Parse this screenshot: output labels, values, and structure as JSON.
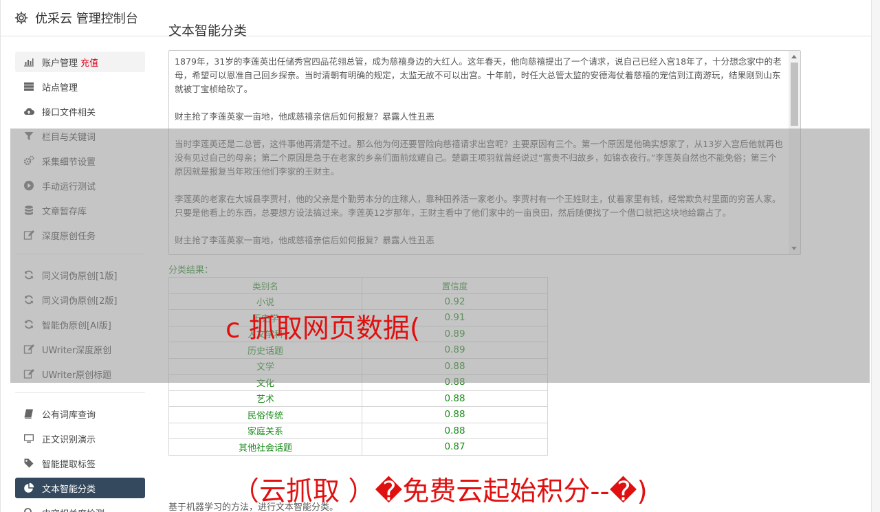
{
  "header": {
    "title": "优采云 管理控制台"
  },
  "sidebar": {
    "group1": [
      {
        "label": "账户管理",
        "badge": "充值",
        "icon": "bar-chart-icon",
        "name": "sidebar-item-account"
      },
      {
        "label": "站点管理",
        "icon": "server-icon",
        "name": "sidebar-item-sites"
      },
      {
        "label": "接口文件相关",
        "icon": "cloud-upload-icon",
        "name": "sidebar-item-interface-files"
      },
      {
        "label": "栏目与关键词",
        "icon": "filter-icon",
        "name": "sidebar-item-keywords"
      },
      {
        "label": "采集细节设置",
        "icon": "gears-icon",
        "name": "sidebar-item-collect-settings"
      },
      {
        "label": "手动运行测试",
        "icon": "play-circle-icon",
        "name": "sidebar-item-manual-test"
      },
      {
        "label": "文章暂存库",
        "icon": "database-icon",
        "name": "sidebar-item-article-store"
      },
      {
        "label": "深度原创任务",
        "icon": "edit-icon",
        "name": "sidebar-item-deep-original"
      }
    ],
    "group2": [
      {
        "label": "同义词伪原创[1版]",
        "icon": "refresh-icon",
        "name": "sidebar-item-synonym-v1"
      },
      {
        "label": "同义词伪原创[2版]",
        "icon": "refresh-icon",
        "name": "sidebar-item-synonym-v2"
      },
      {
        "label": "智能伪原创[AI版]",
        "icon": "refresh-icon",
        "name": "sidebar-item-ai-rewrite"
      },
      {
        "label": "UWriter深度原创",
        "icon": "edit-icon",
        "name": "sidebar-item-uwriter"
      },
      {
        "label": "UWriter原创标题",
        "icon": "edit-icon",
        "name": "sidebar-item-uwriter-title"
      }
    ],
    "group3": [
      {
        "label": "公有词库查询",
        "icon": "book-icon",
        "name": "sidebar-item-public-dict"
      },
      {
        "label": "正文识别演示",
        "icon": "monitor-icon",
        "name": "sidebar-item-text-recognition"
      },
      {
        "label": "智能提取标签",
        "icon": "tag-icon",
        "name": "sidebar-item-extract-tags"
      },
      {
        "label": "文本智能分类",
        "icon": "pie-chart-icon",
        "name": "sidebar-item-text-classify"
      },
      {
        "label": "内容相关度检测",
        "icon": "search-icon",
        "name": "sidebar-item-relevance"
      }
    ]
  },
  "main": {
    "title": "文本智能分类",
    "paragraphs": [
      "1879年，31岁的李莲英出任储秀宫四品花翎总管，成为慈禧身边的大红人。这年春天，他向慈禧提出了一个请求，说自己已经入宫18年了，十分想念家中的老母，希望可以恩准自己回乡探亲。当时清朝有明确的规定，太监无故不可以出宫。十年前，时任大总管太监的安德海仗着慈禧的宠信到江南游玩，结果刚到山东就被丁宝桢给砍了。",
      "财主抢了李莲英家一亩地，他成慈禧亲信后如何报复？暴露人性丑恶",
      "当时李莲英还是二总管，这件事他再清楚不过。那么他为何还要冒险向慈禧请求出宫呢？主要原因有三个。第一个原因是他确实想家了，从13岁入宫后他就再也没有见过自己的母亲；第二个原因是急于在老家的乡亲们面前炫耀自己。楚霸王项羽就曾经说过“富贵不归故乡，如锦衣夜行。”李莲英自然也不能免俗；第三个原因就是报复当年欺压他们李家的王财主。",
      "李莲英的老家在大城县李贾村，他的父亲是个勤劳本分的庄稼人，靠种田养活一家老小。李贾村有一个王姓财主，仗着家里有钱，经常欺负村里面的穷苦人家。只要是他看上的东西，总要想方设法搞过来。李莲英12岁那年，王财主看中了他们家中的一亩良田，然后随便找了一个借口就把这块地给霸占了。",
      "财主抢了李莲英家一亩地，他成慈禧亲信后如何报复？暴露人性丑恶"
    ],
    "result_label": "分类结果：",
    "table": {
      "headers": [
        "类别名",
        "置信度"
      ],
      "rows": [
        [
          "小说",
          "0.92"
        ],
        [
          "历史学",
          "0.91"
        ],
        [
          "人文学科",
          "0.89"
        ],
        [
          "历史话题",
          "0.89"
        ],
        [
          "文学",
          "0.88"
        ],
        [
          "文化",
          "0.88"
        ],
        [
          "艺术",
          "0.88"
        ],
        [
          "民俗传统",
          "0.88"
        ],
        [
          "家庭关系",
          "0.88"
        ],
        [
          "其他社会话题",
          "0.87"
        ]
      ]
    },
    "footnote": "基于机器学习的方法，进行文本智能分类。"
  },
  "watermarks": {
    "top": "c 抓取网页数据(",
    "bottom": "（云抓取 ）�免费云起始积分--�)"
  }
}
